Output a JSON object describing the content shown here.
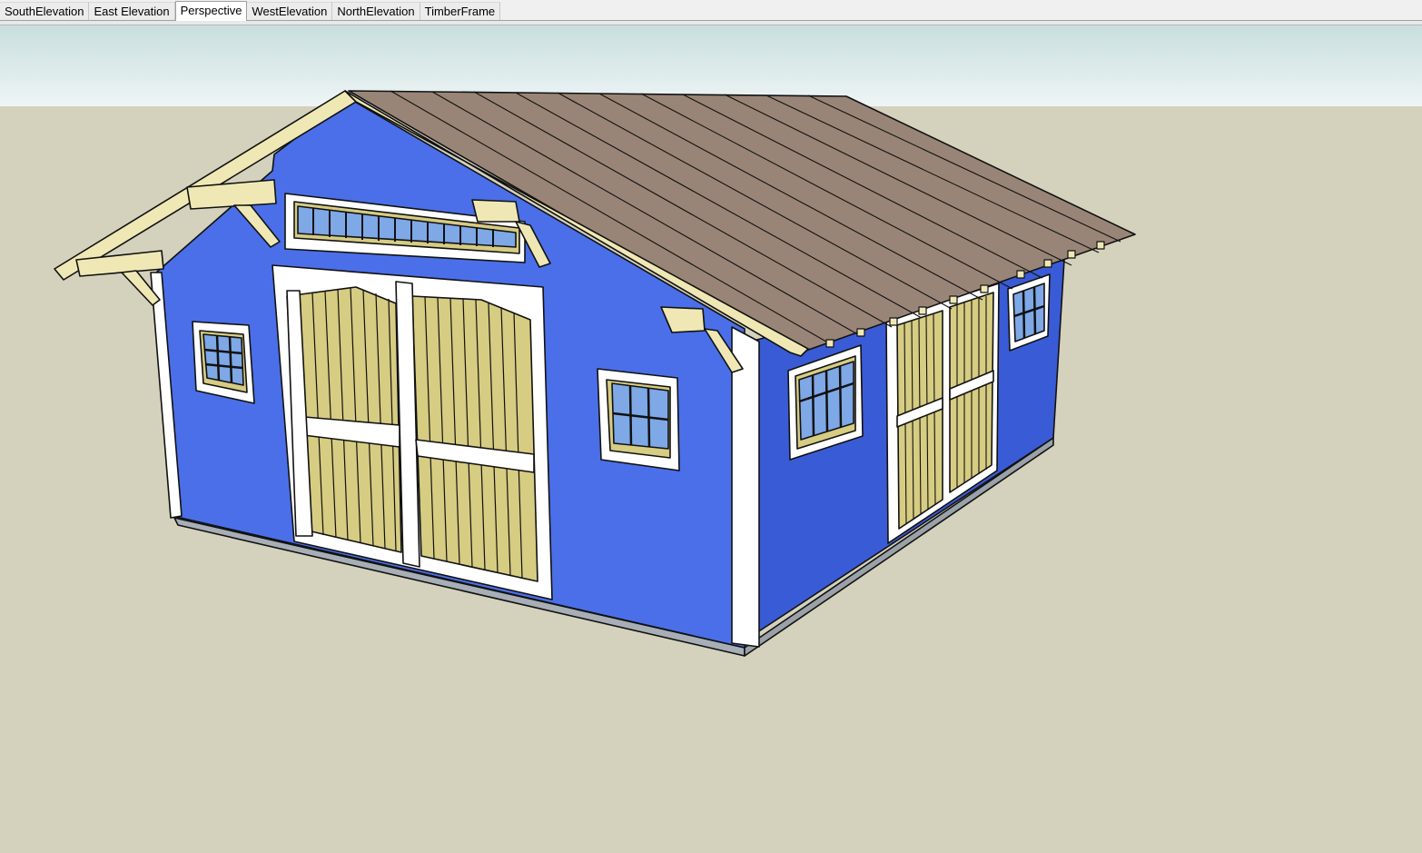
{
  "tabs": [
    {
      "label": "SouthElevation",
      "active": false
    },
    {
      "label": "East Elevation",
      "active": false
    },
    {
      "label": "Perspective",
      "active": true
    },
    {
      "label": "WestElevation",
      "active": false
    },
    {
      "label": "NorthElevation",
      "active": false
    },
    {
      "label": "TimberFrame",
      "active": false
    }
  ],
  "scene": {
    "colors": {
      "sky_top": "#c9dede",
      "sky_bottom": "#eef5f5",
      "ground": "#d4d1bd",
      "wall_front": "#4a6fe8",
      "wall_side": "#3a5bd6",
      "trim": "#ffffff",
      "door_panel": "#d6cc82",
      "roof": "#998577",
      "timber": "#f0e8b4",
      "glass": "#7ea8e6"
    }
  }
}
